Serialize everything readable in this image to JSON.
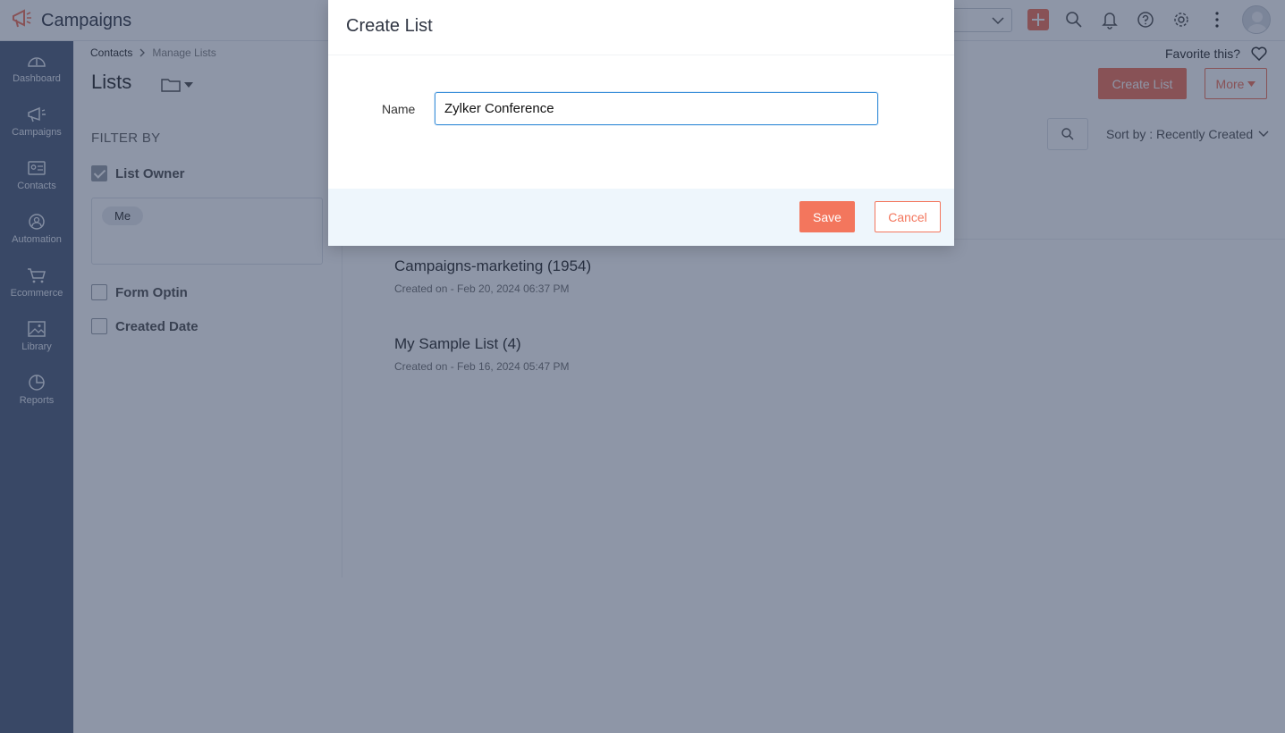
{
  "app": {
    "title": "Campaigns"
  },
  "colors": {
    "accent": "#f3765d",
    "sidebar": "#54627d",
    "input_focus": "#3a8fd9",
    "overlay": "rgba(30,45,80,0.5)"
  },
  "topbar": {
    "icons": [
      "dropdown-chevron-icon",
      "add-icon",
      "search-icon",
      "bell-icon",
      "help-icon",
      "gear-icon",
      "more-vertical-icon",
      "avatar"
    ]
  },
  "sidebar": {
    "items": [
      {
        "label": "Dashboard",
        "icon": "dashboard-icon"
      },
      {
        "label": "Campaigns",
        "icon": "megaphone-icon"
      },
      {
        "label": "Contacts",
        "icon": "contact-card-icon"
      },
      {
        "label": "Automation",
        "icon": "automation-icon"
      },
      {
        "label": "Ecommerce",
        "icon": "cart-icon"
      },
      {
        "label": "Library",
        "icon": "image-icon"
      },
      {
        "label": "Reports",
        "icon": "pie-chart-icon"
      }
    ]
  },
  "breadcrumb": {
    "parent": "Contacts",
    "current": "Manage Lists"
  },
  "page": {
    "title": "Lists",
    "favorite_label": "Favorite this?",
    "create_button": "Create List",
    "more_button": "More",
    "sort_label": "Sort by : Recently Created"
  },
  "filters": {
    "title": "FILTER BY",
    "list_owner": {
      "label": "List Owner",
      "checked": true,
      "chip": "Me"
    },
    "form_optin": {
      "label": "Form Optin",
      "checked": false
    },
    "created_date": {
      "label": "Created Date",
      "checked": false
    }
  },
  "lists": [
    {
      "name": "Campaigns-marketing (1954)",
      "created": "Created on - Feb 20, 2024 06:37 PM"
    },
    {
      "name": "My Sample List (4)",
      "created": "Created on - Feb 16, 2024 05:47 PM"
    }
  ],
  "modal": {
    "title": "Create List",
    "name_label": "Name",
    "name_value": "Zylker Conference",
    "save_label": "Save",
    "cancel_label": "Cancel"
  }
}
